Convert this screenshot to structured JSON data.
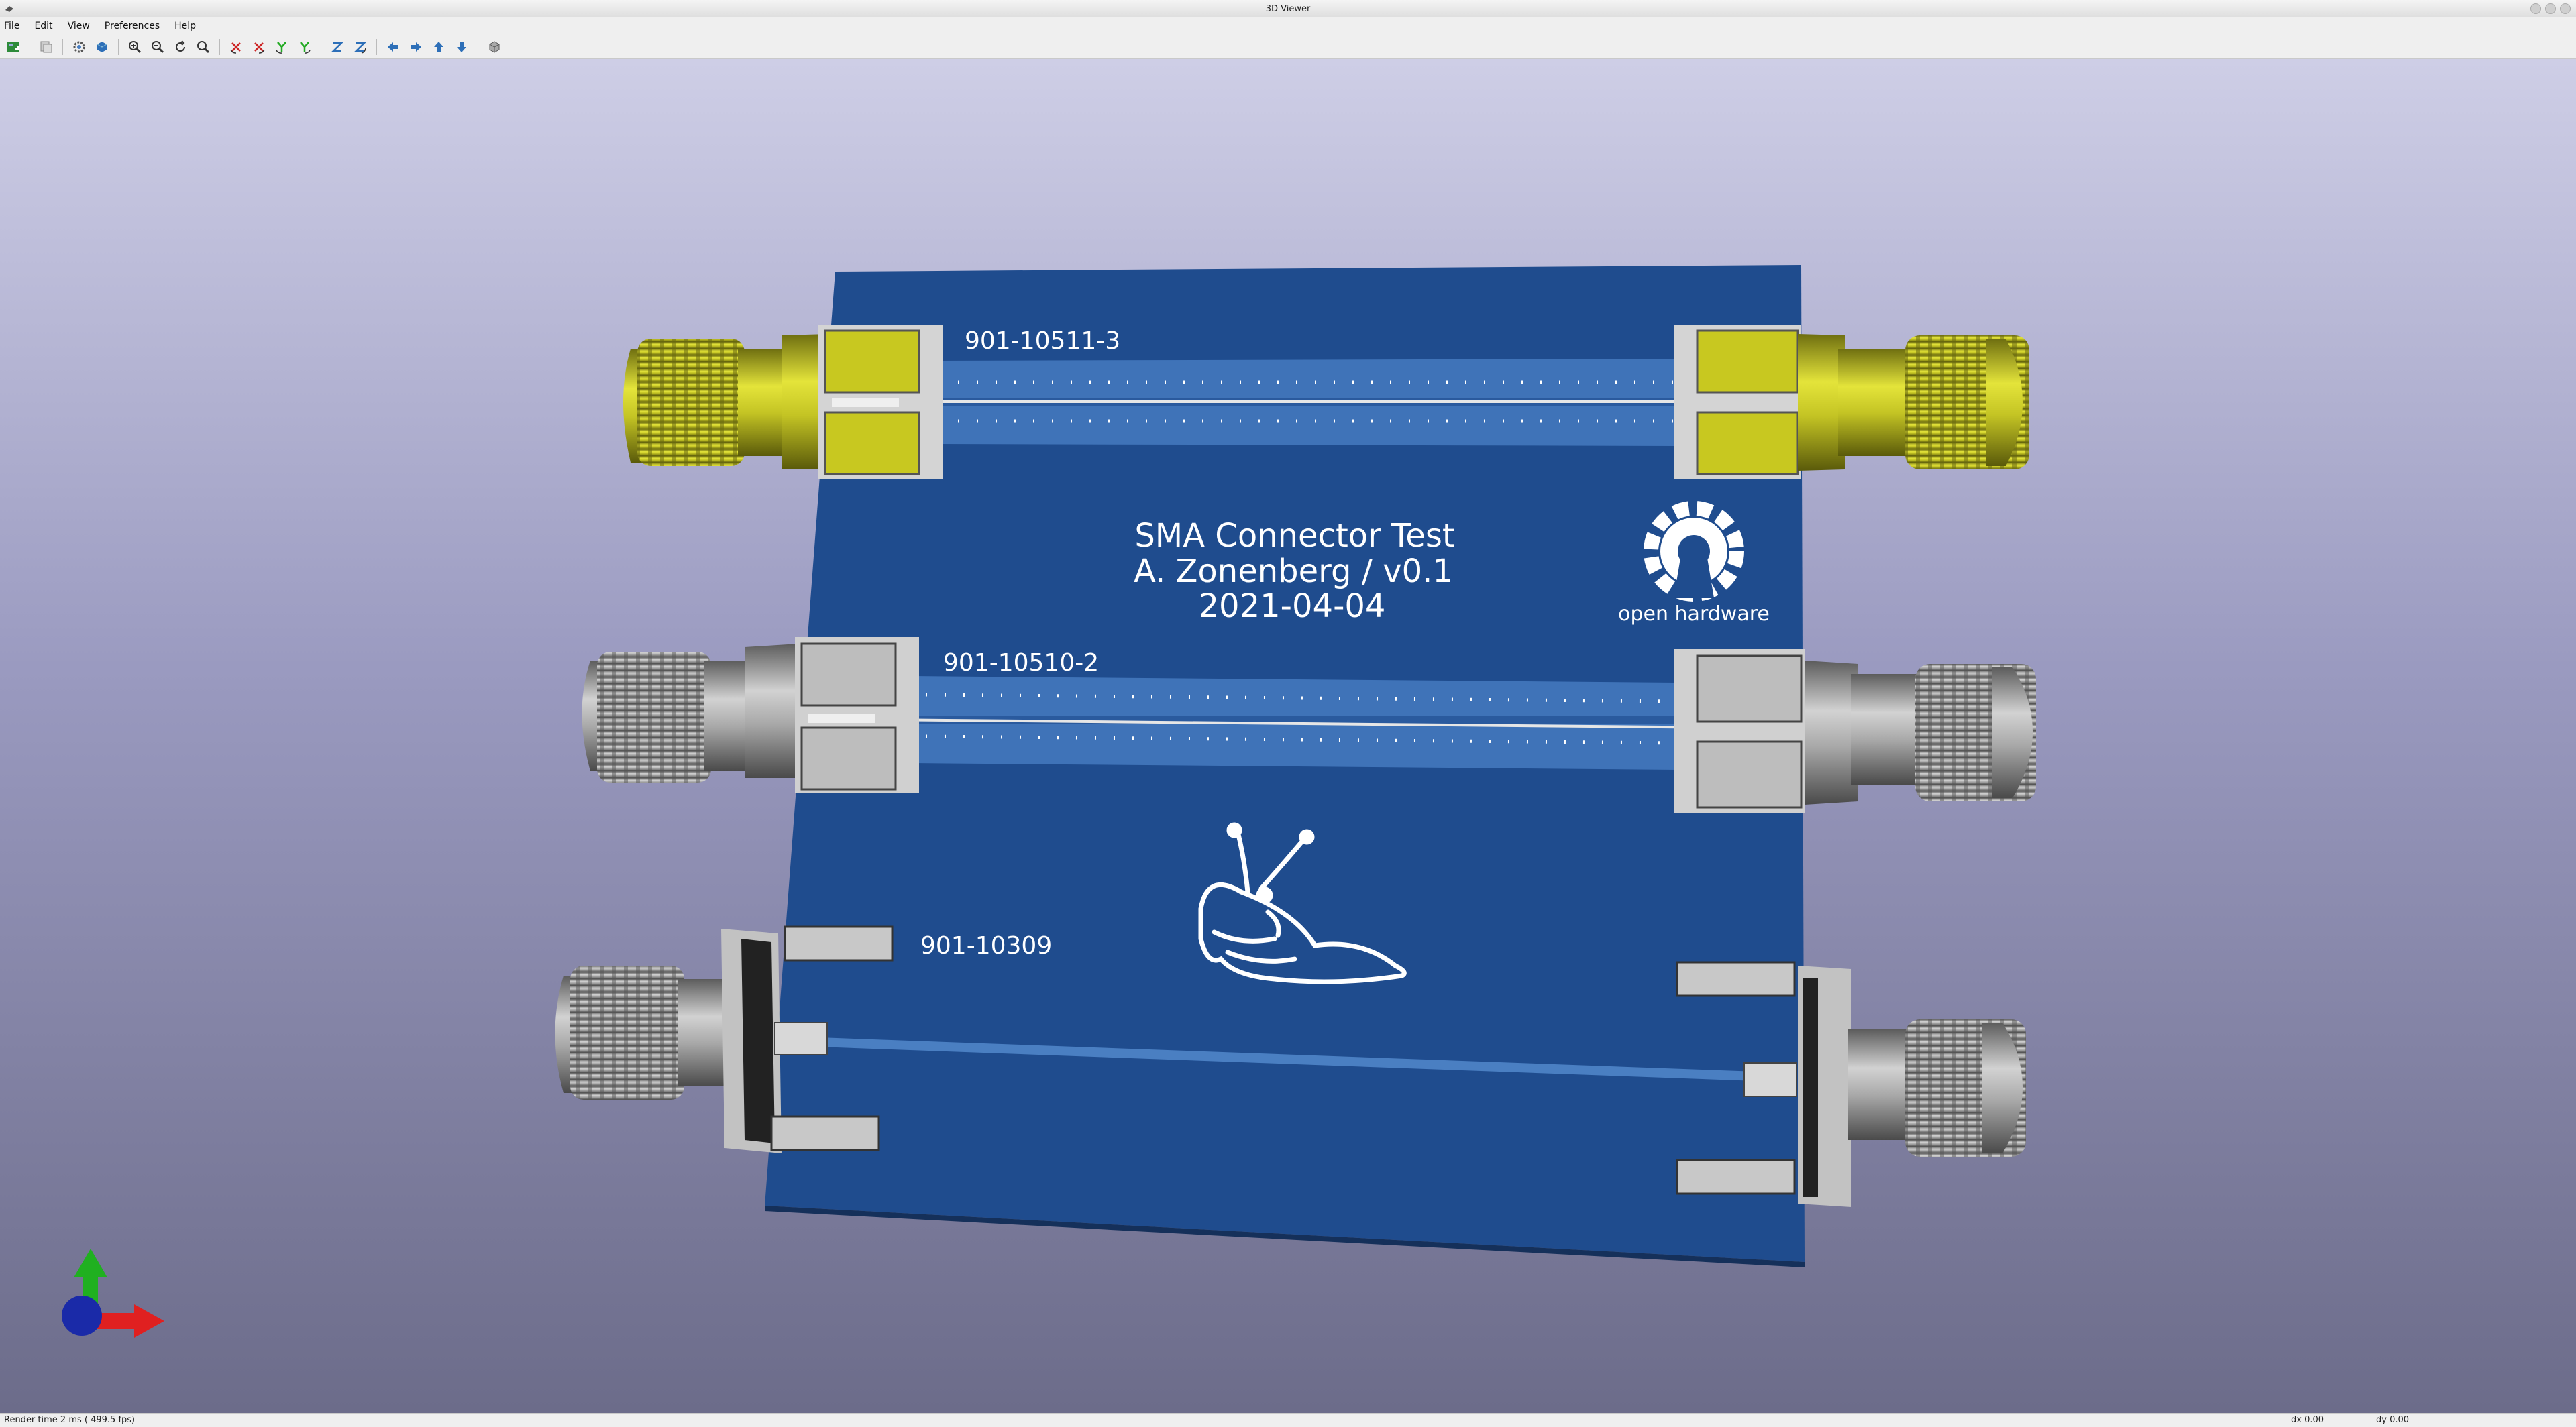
{
  "window": {
    "title": "3D Viewer"
  },
  "menu": {
    "items": [
      "File",
      "Edit",
      "View",
      "Preferences",
      "Help"
    ]
  },
  "toolbar": {
    "buttons": [
      "reload-board-icon",
      "copy-image-icon",
      "render-options-icon",
      "raytracing-icon",
      "zoom-in-icon",
      "zoom-out-icon",
      "redraw-icon",
      "zoom-fit-icon",
      "rotate-x-cw-icon",
      "rotate-x-ccw-icon",
      "rotate-y-cw-icon",
      "rotate-y-ccw-icon",
      "rotate-z-cw-icon",
      "rotate-z-ccw-icon",
      "pan-left-icon",
      "pan-right-icon",
      "pan-up-icon",
      "pan-down-icon",
      "ortho-toggle-icon"
    ]
  },
  "board": {
    "title_lines": [
      "SMA Connector Test",
      "A. Zonenberg / v0.1",
      "2021-04-04"
    ],
    "logo_text": "open hardware",
    "connector_labels": [
      "901-10511-3",
      "901-10510-2",
      "901-10309"
    ],
    "colors": {
      "pcb": "#1e4b8c",
      "trace": "#4a7fc2",
      "silkscreen": "#ffffff",
      "gold": "#bdbd22",
      "steel": "#9c9c9c"
    }
  },
  "status": {
    "render_time": "Render time 2 ms ( 499.5 fps)",
    "dx": "dx 0.00",
    "dy": "dy 0.00"
  }
}
